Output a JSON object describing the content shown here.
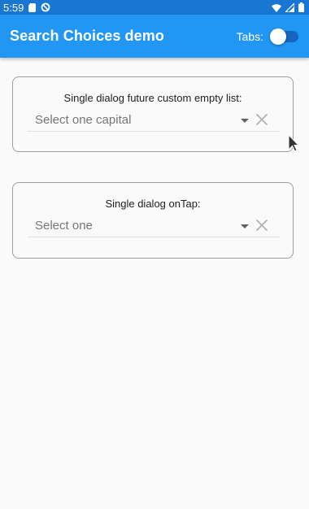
{
  "status_bar": {
    "time": "5:59"
  },
  "app_bar": {
    "title": "Search Choices demo",
    "tabs_label": "Tabs:",
    "tabs_switch_on": false
  },
  "cards": [
    {
      "hint": "Single dialog future custom empty list:",
      "placeholder": "Select one capital"
    },
    {
      "hint": "Single dialog onTap:",
      "placeholder": "Select one"
    }
  ],
  "colors": {
    "app_bar": "#2196f3",
    "status_bar": "#1976d2",
    "background": "#fafafa"
  }
}
